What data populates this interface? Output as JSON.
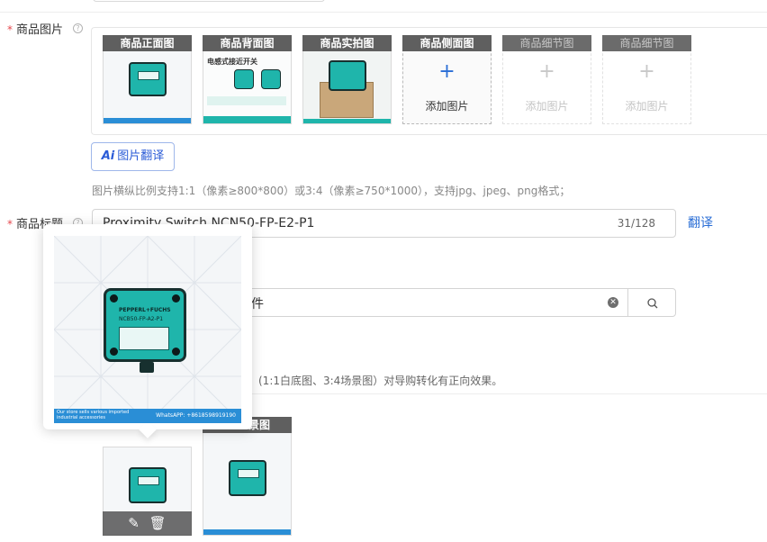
{
  "images_section": {
    "label": "商品图片",
    "required_mark": "*",
    "help_glyph": "?",
    "slots": [
      {
        "caption": "商品正面图",
        "filled": true
      },
      {
        "caption": "商品背面图",
        "filled": true,
        "overlay_text": "电感式接近开关"
      },
      {
        "caption": "商品实拍图",
        "filled": true
      },
      {
        "caption": "商品侧面图",
        "filled": false,
        "add_label": "添加图片",
        "plus": "+"
      },
      {
        "caption": "商品细节图",
        "filled": false,
        "add_label": "添加图片",
        "plus": "+"
      },
      {
        "caption": "商品细节图",
        "filled": false,
        "add_label": "添加图片",
        "plus": "+"
      }
    ],
    "ai_translate_button": {
      "icon_text": "Ai",
      "label": "图片翻译"
    },
    "hint": "图片横纵比例支持1:1（像素≥800*800）或3:4（像素≥750*1000），支持jpg、jpeg、png格式；"
  },
  "title_section": {
    "label": "商品标题",
    "required_mark": "*",
    "help_glyph": "?",
    "value": "Proximity Switch NCN50-FP-E2-P1",
    "counter": "31/128",
    "translate_link": "翻译"
  },
  "category_section": {
    "search_value_visible": "件",
    "clear_icon": "clear-icon",
    "search_icon": "search-icon"
  },
  "marketing_images": {
    "hint_visible": "(1:1白底图、3:4场景图）对导购转化有正向效果。",
    "slot2_caption_visible": "景图"
  },
  "preview_popover": {
    "watermark_left": "Our store sells various imported industrial accessories",
    "watermark_right": "WhatsAPP: +8618598919190",
    "sensor_model": "NCB50-FP-A2-P1",
    "brand": "PEPPERL+FUCHS"
  },
  "colors": {
    "required": "#e5484d",
    "link": "#2a6ed6",
    "sensor_teal": "#1fb5ab",
    "caption_bg": "#5f5f5f"
  }
}
